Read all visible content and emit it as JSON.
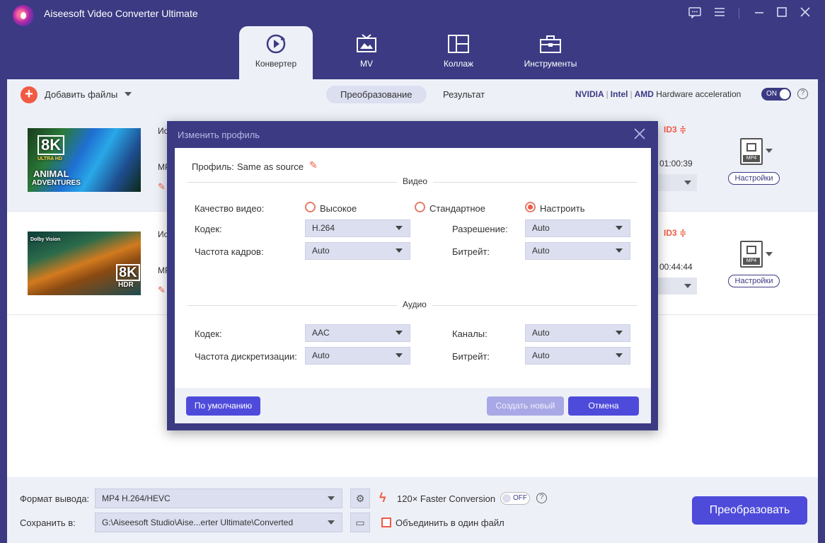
{
  "app": {
    "title": "Aiseesoft Video Converter Ultimate"
  },
  "nav": {
    "tabs": [
      {
        "label": "Конвертер",
        "icon": "convert-icon",
        "active": true
      },
      {
        "label": "MV",
        "icon": "tv-icon",
        "active": false
      },
      {
        "label": "Коллаж",
        "icon": "collage-icon",
        "active": false
      },
      {
        "label": "Инструменты",
        "icon": "toolbox-icon",
        "active": false
      }
    ]
  },
  "toolbar": {
    "add_files": "Добавить файлы",
    "seg_convert": "Преобразование",
    "seg_result": "Результат",
    "hw_nvidia": "NVIDIA",
    "hw_intel": "Intel",
    "hw_amd": "AMD",
    "hw_label": "Hardware acceleration",
    "hw_toggle": "ON"
  },
  "files": [
    {
      "src_prefix": "Ис",
      "fmt_prefix": "MP",
      "duration": "01:00:39",
      "thumb_text_1": "8K",
      "thumb_text_2": "ULTRA HD",
      "thumb_text_3": "ANIMAL",
      "thumb_text_4": "ADVENTURES",
      "format_tag": "MP4",
      "settings": "Настройки"
    },
    {
      "src_prefix": "Ис",
      "fmt_prefix": "MP",
      "duration": "00:44:44",
      "thumb_text_1": "Dolby Vision",
      "thumb_text_2": "8K",
      "thumb_text_3": "HDR",
      "format_tag": "MP4",
      "settings": "Настройки"
    }
  ],
  "bottom": {
    "format_label": "Формат вывода:",
    "format_value": "MP4 H.264/HEVC",
    "save_label": "Сохранить в:",
    "save_value": "G:\\Aiseesoft Studio\\Aise...erter Ultimate\\Converted",
    "faster": "120× Faster Conversion",
    "faster_toggle": "OFF",
    "merge": "Объединить в один файл",
    "convert": "Преобразовать"
  },
  "modal": {
    "title": "Изменить профиль",
    "profile_label": "Профиль:",
    "profile_value": "Same as source",
    "video_section": "Видео",
    "audio_section": "Аудио",
    "quality_label": "Качество видео:",
    "quality_options": [
      "Высокое",
      "Стандартное",
      "Настроить"
    ],
    "quality_selected": "Настроить",
    "codec_label": "Кодек:",
    "codec_value": "H.264",
    "resolution_label": "Разрешение:",
    "resolution_value": "Auto",
    "framerate_label": "Частота кадров:",
    "framerate_value": "Auto",
    "bitrate_label": "Битрейт:",
    "bitrate_value": "Auto",
    "a_codec_label": "Кодек:",
    "a_codec_value": "AAC",
    "channels_label": "Каналы:",
    "channels_value": "Auto",
    "samplerate_label": "Частота дискретизации:",
    "samplerate_value": "Auto",
    "a_bitrate_label": "Битрейт:",
    "a_bitrate_value": "Auto",
    "btn_default": "По умолчанию",
    "btn_new": "Создать новый",
    "btn_cancel": "Отмена"
  },
  "colors": {
    "accent": "#3b3a83",
    "primary_button": "#4e4bdb",
    "orange": "#f15a43"
  }
}
